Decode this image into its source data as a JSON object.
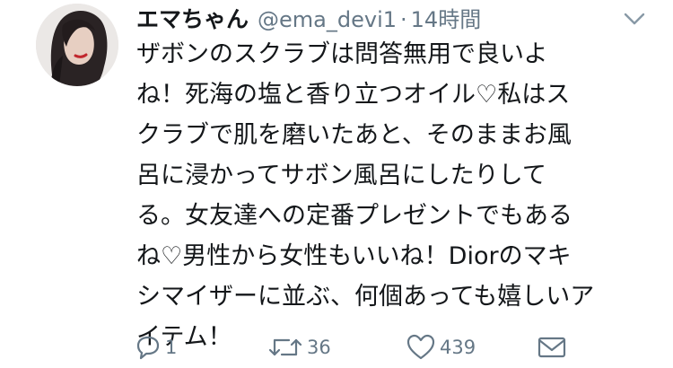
{
  "tweet": {
    "display_name": "エマちゃん",
    "handle": "@ema_devi1",
    "separator": "·",
    "time": "14時間",
    "text": "ザボンのスクラブは問答無用で良いよ\nね！死海の塩と香り立つオイル♡私はス\nクラブで肌を磨いたあと、そのままお風\n呂に浸かってサボン風呂にしたりして\nる。女友達への定番プレゼントでもある\nね♡男性から女性もいいね！Diorのマキ\nシマイザーに並ぶ、何個あっても嬉しいア\nイテム！"
  },
  "actions": {
    "reply_count": "1",
    "retweet_count": "36",
    "like_count": "439"
  },
  "colors": {
    "text": "#14171a",
    "muted": "#657786",
    "background": "#ffffff"
  },
  "icons": {
    "reply": "reply-icon",
    "retweet": "retweet-icon",
    "like": "heart-icon",
    "dm": "envelope-icon",
    "menu": "chevron-down-icon"
  }
}
